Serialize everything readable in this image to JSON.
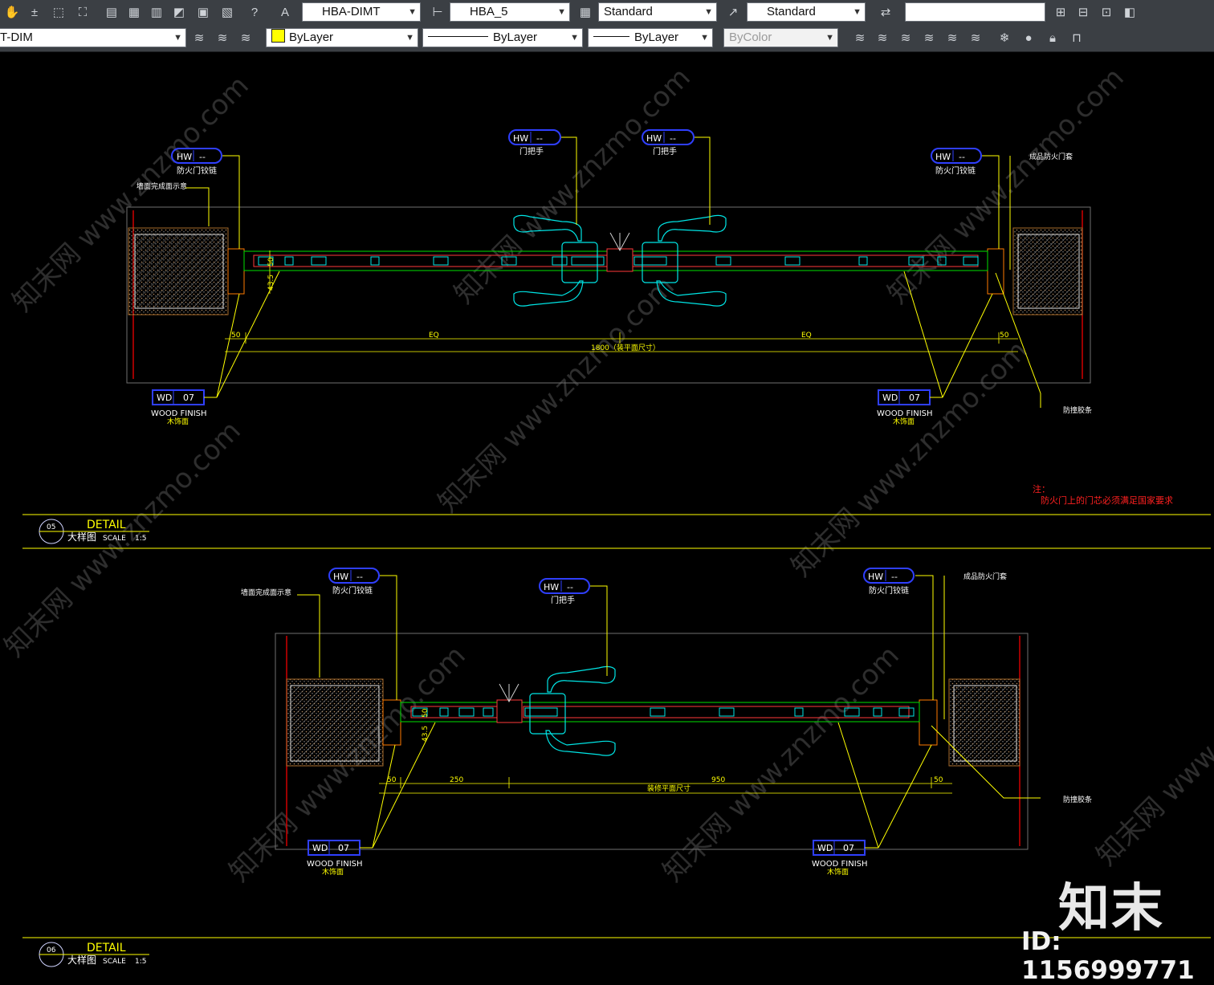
{
  "toolbar1": {
    "dimstyle": "HBA-DIMT",
    "textstyle": "HBA_5",
    "tablestyle": "Standard",
    "mleaderstyle": "Standard",
    "search_value": ""
  },
  "toolbar2": {
    "layer": "T-DIM",
    "color": "ByLayer",
    "linetype": "ByLayer",
    "lineweight": "ByLayer",
    "plotstyle": "ByColor"
  },
  "drawing": {
    "detail1": {
      "tags": [
        {
          "code": "HW",
          "num": "-- ",
          "label": "防火门铰链"
        },
        {
          "code": "HW",
          "num": "-- ",
          "label": "门把手"
        },
        {
          "code": "HW",
          "num": "-- ",
          "label": "门把手"
        },
        {
          "code": "HW",
          "num": "-- ",
          "label": "防火门铰链"
        }
      ],
      "wall_note": "墙面完成面示意",
      "frame_note": "成品防火门套",
      "strip_note": "防撞胶条",
      "dims": {
        "left": "50",
        "mid1": "EQ",
        "mid2": "EQ",
        "right": "50",
        "total": "1800（装平面尺寸）",
        "v1": "50",
        "v2": "43.5"
      },
      "wd_tags": [
        {
          "code": "WD",
          "num": "07",
          "finish": "WOOD FINISH",
          "cn": "木饰面"
        },
        {
          "code": "WD",
          "num": "07",
          "finish": "WOOD FINISH",
          "cn": "木饰面"
        }
      ],
      "note_title": "注：",
      "note_text": "防火门上的门芯必须满足国家要求",
      "title": {
        "num": "05",
        "detail": "DETAIL",
        "cn": "大样图",
        "scale": "SCALE",
        "ratio": "1:5"
      }
    },
    "detail2": {
      "tags": [
        {
          "code": "HW",
          "num": "-- ",
          "label": "防火门铰链"
        },
        {
          "code": "HW",
          "num": "-- ",
          "label": "门把手"
        },
        {
          "code": "HW",
          "num": "-- ",
          "label": "防火门铰链"
        }
      ],
      "wall_note": "墙面完成面示意",
      "frame_note": "成品防火门套",
      "strip_note": "防撞胶条",
      "dims": {
        "left": "50",
        "a": "250",
        "b": "950",
        "right": "50",
        "total": "装修平面尺寸",
        "v1": "50",
        "v2": "43.5"
      },
      "wd_tags": [
        {
          "code": "WD",
          "num": "07",
          "finish": "WOOD FINISH",
          "cn": "木饰面"
        },
        {
          "code": "WD",
          "num": "07",
          "finish": "WOOD FINISH",
          "cn": "木饰面"
        }
      ],
      "title": {
        "num": "06",
        "detail": "DETAIL",
        "cn": "大样图",
        "scale": "SCALE",
        "ratio": "1:5"
      }
    }
  },
  "watermark": {
    "site": "www.znzmo.com",
    "cn": "知末网",
    "brand": "知末",
    "id": "ID: 1156999771"
  },
  "colors": {
    "canvas": "#000000",
    "yellow": "#ffff00",
    "cyan": "#00ffff",
    "red": "#ff0000",
    "blue": "#2f3fff",
    "orange": "#ff8a00"
  }
}
